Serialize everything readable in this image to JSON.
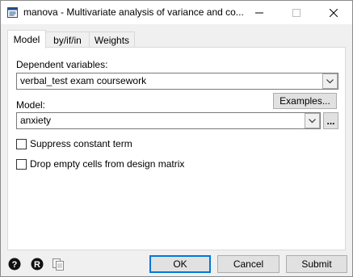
{
  "window": {
    "title": "manova - Multivariate analysis of variance and co...",
    "minimize_symbol": "—",
    "maximize_symbol": "☐",
    "close_symbol": "✕"
  },
  "tabs": [
    {
      "label": "Model",
      "active": true
    },
    {
      "label": "by/if/in",
      "active": false
    },
    {
      "label": "Weights",
      "active": false
    }
  ],
  "form": {
    "dependent_label": "Dependent variables:",
    "dependent_value": "verbal_test exam coursework",
    "examples_label": "Examples...",
    "model_label": "Model:",
    "model_value": "anxiety",
    "browse_label": "...",
    "suppress_label": "Suppress constant term",
    "suppress_checked": false,
    "drop_label": "Drop empty cells from design matrix",
    "drop_checked": false
  },
  "footer": {
    "help_icon_glyph": "?",
    "reset_icon_glyph": "R",
    "ok_label": "OK",
    "cancel_label": "Cancel",
    "submit_label": "Submit"
  },
  "colors": {
    "accent": "#0078d7",
    "panel": "#ffffff",
    "chrome": "#f0f0f0"
  }
}
